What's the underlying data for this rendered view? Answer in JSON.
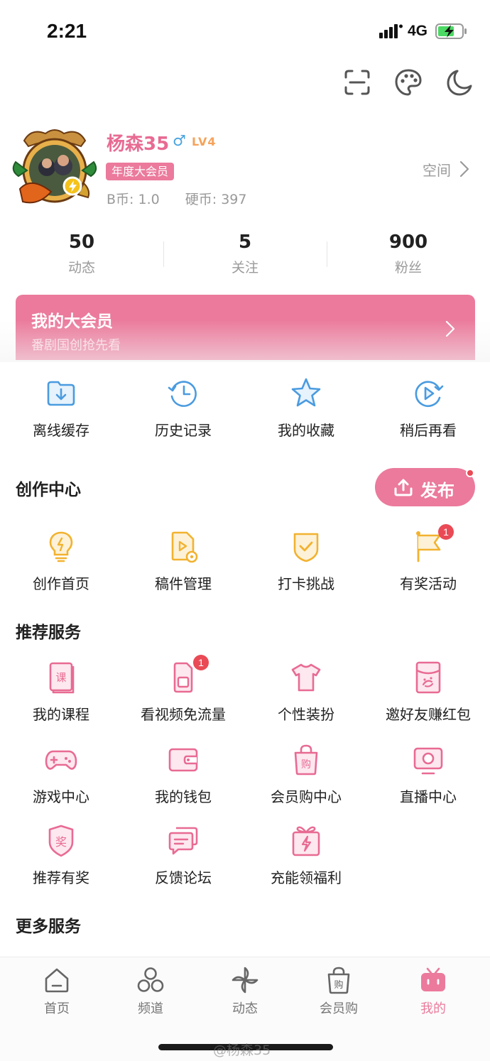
{
  "status_bar": {
    "time": "2:21",
    "network": "4G"
  },
  "profile": {
    "username": "杨森35",
    "gender_symbol": "♂",
    "level": "LV4",
    "vip_badge": "年度大会员",
    "b_coins": "B币: 1.0",
    "hard_coins": "硬币: 397",
    "space_label": "空间"
  },
  "stats": [
    {
      "value": "50",
      "label": "动态"
    },
    {
      "value": "5",
      "label": "关注"
    },
    {
      "value": "900",
      "label": "粉丝"
    }
  ],
  "vip_card": {
    "title": "我的大会员",
    "subtitle": "番剧国创抢先看"
  },
  "quick_actions": [
    {
      "label": "离线缓存",
      "icon": "download-folder-icon"
    },
    {
      "label": "历史记录",
      "icon": "history-clock-icon"
    },
    {
      "label": "我的收藏",
      "icon": "star-icon"
    },
    {
      "label": "稍后再看",
      "icon": "watch-later-icon"
    }
  ],
  "creation_center": {
    "title": "创作中心",
    "publish_label": "发布",
    "items": [
      {
        "label": "创作首页",
        "icon": "lightbulb-icon"
      },
      {
        "label": "稿件管理",
        "icon": "document-gear-icon"
      },
      {
        "label": "打卡挑战",
        "icon": "check-shield-icon"
      },
      {
        "label": "有奖活动",
        "icon": "flag-icon",
        "badge": "1"
      }
    ]
  },
  "recommended_services": {
    "title": "推荐服务",
    "items": [
      {
        "label": "我的课程",
        "icon": "course-book-icon",
        "glyph": "课"
      },
      {
        "label": "看视频免流量",
        "icon": "sim-card-icon",
        "badge": "1"
      },
      {
        "label": "个性装扮",
        "icon": "tshirt-icon"
      },
      {
        "label": "邀好友赚红包",
        "icon": "red-envelope-icon"
      },
      {
        "label": "游戏中心",
        "icon": "gamepad-icon"
      },
      {
        "label": "我的钱包",
        "icon": "wallet-icon"
      },
      {
        "label": "会员购中心",
        "icon": "shopping-bag-icon",
        "glyph": "购"
      },
      {
        "label": "直播中心",
        "icon": "live-tv-icon"
      },
      {
        "label": "推荐有奖",
        "icon": "reward-shield-icon",
        "glyph": "奖"
      },
      {
        "label": "反馈论坛",
        "icon": "chat-bubbles-icon"
      },
      {
        "label": "充能领福利",
        "icon": "gift-box-icon"
      }
    ]
  },
  "more_services": {
    "title": "更多服务"
  },
  "tabbar": [
    {
      "label": "首页",
      "icon": "home-icon"
    },
    {
      "label": "频道",
      "icon": "channels-icon"
    },
    {
      "label": "动态",
      "icon": "pinwheel-icon"
    },
    {
      "label": "会员购",
      "icon": "shopping-bag-icon",
      "glyph": "购"
    },
    {
      "label": "我的",
      "icon": "tv-face-icon",
      "active": true
    }
  ],
  "watermark": "@杨森35",
  "colors": {
    "accent": "#eb7a9c",
    "blue_icon": "#4a9be0",
    "yellow_icon": "#f2b230",
    "pink_icon": "#e86b93",
    "badge": "#e94a55"
  }
}
